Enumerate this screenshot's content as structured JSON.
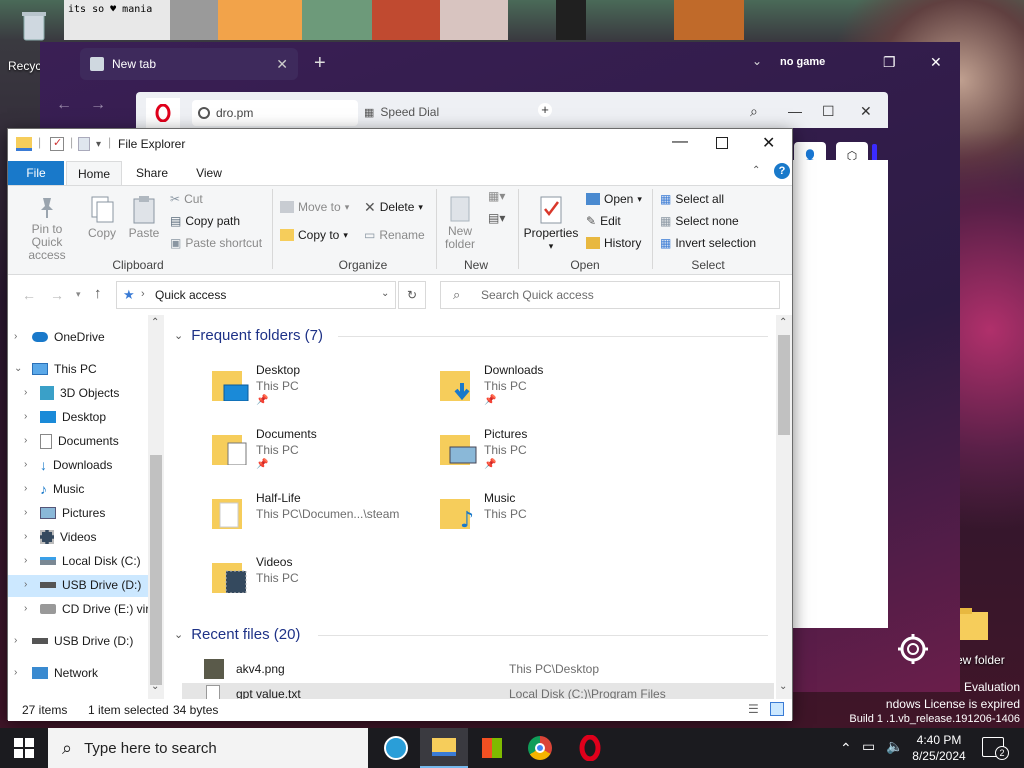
{
  "desktop": {
    "recycle_label": "Recyc",
    "new_folder_label": "ew folder",
    "thumb_text": "its so ♥ mania",
    "watermark_line1": "Evaluation",
    "watermark_line2": "ndows License is expired",
    "watermark_line3": "Build 1 .1.vb_release.191206-1406"
  },
  "opera": {
    "tab_title": "New tab",
    "address": "dro.pm",
    "speed_dial": "Speed Dial",
    "badge": "no game"
  },
  "explorer": {
    "title": "File Explorer",
    "ribbon_tabs": [
      "File",
      "Home",
      "Share",
      "View"
    ],
    "clipboard": {
      "pin": "Pin to Quick access",
      "copy": "Copy",
      "paste": "Paste",
      "cut": "Cut",
      "copy_path": "Copy path",
      "paste_shortcut": "Paste shortcut",
      "label": "Clipboard"
    },
    "organize": {
      "move_to": "Move to",
      "copy_to": "Copy to",
      "delete": "Delete",
      "rename": "Rename",
      "label": "Organize"
    },
    "new": {
      "new_folder": "New folder",
      "label": "New"
    },
    "open": {
      "properties": "Properties",
      "open": "Open",
      "edit": "Edit",
      "history": "History",
      "label": "Open"
    },
    "select": {
      "select_all": "Select all",
      "select_none": "Select none",
      "invert": "Invert selection",
      "label": "Select"
    },
    "address": "Quick access",
    "search_placeholder": "Search Quick access",
    "nav": [
      {
        "label": "OneDrive"
      },
      {
        "label": "This PC"
      },
      {
        "label": "3D Objects"
      },
      {
        "label": "Desktop"
      },
      {
        "label": "Documents"
      },
      {
        "label": "Downloads"
      },
      {
        "label": "Music"
      },
      {
        "label": "Pictures"
      },
      {
        "label": "Videos"
      },
      {
        "label": "Local Disk (C:)"
      },
      {
        "label": "USB Drive (D:)"
      },
      {
        "label": "CD Drive (E:) virt"
      },
      {
        "label": "USB Drive (D:)"
      },
      {
        "label": "Network"
      }
    ],
    "frequent_header": "Frequent folders (7)",
    "folders": [
      {
        "name": "Desktop",
        "location": "This PC"
      },
      {
        "name": "Downloads",
        "location": "This PC"
      },
      {
        "name": "Documents",
        "location": "This PC"
      },
      {
        "name": "Pictures",
        "location": "This PC"
      },
      {
        "name": "Half-Life",
        "location": "This PC\\Documen...\\steam"
      },
      {
        "name": "Music",
        "location": "This PC"
      },
      {
        "name": "Videos",
        "location": "This PC"
      }
    ],
    "recent_header": "Recent files (20)",
    "recent": [
      {
        "name": "akv4.png",
        "location": "This PC\\Desktop"
      },
      {
        "name": "gpt value.txt",
        "location": "Local Disk (C:)\\Program Files (...\\TableTextService"
      }
    ],
    "status": {
      "items": "27 items",
      "selected": "1 item selected",
      "size": "34 bytes"
    }
  },
  "taskbar": {
    "search_placeholder": "Type here to search",
    "time": "4:40 PM",
    "date": "8/25/2024",
    "notification_count": "2"
  },
  "colors": {
    "accent": "#1979ca",
    "folder_yellow": "#f6cd5b",
    "selection": "#cce8ff"
  }
}
